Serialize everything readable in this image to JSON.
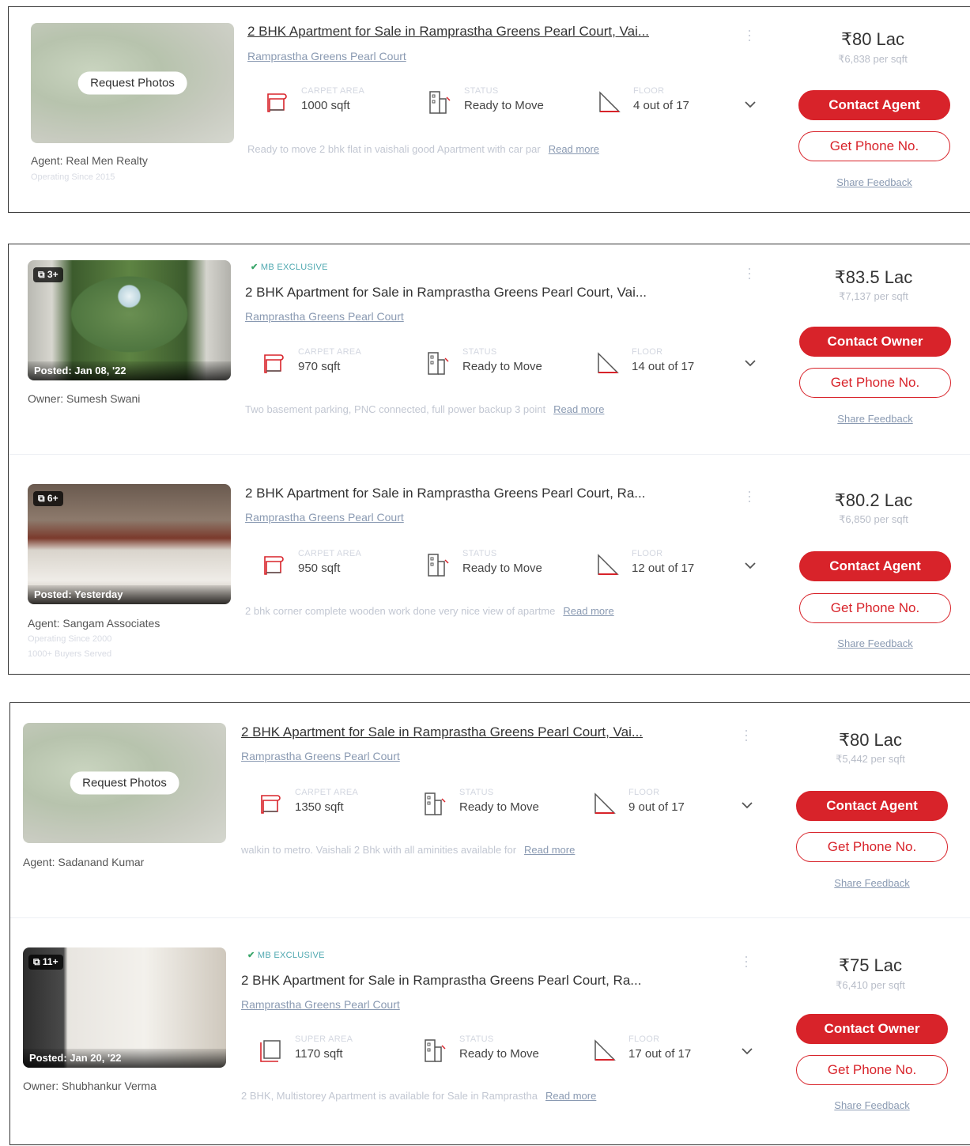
{
  "listings": [
    {
      "photo": {
        "type": "request",
        "request_label": "Request Photos"
      },
      "agent": "Agent: Real Men Realty",
      "agent_sub": [
        "Operating Since 2015"
      ],
      "exclusive": "",
      "title": "2 BHK Apartment for Sale in Ramprastha Greens Pearl Court, Vai...",
      "project": "Ramprastha Greens Pearl Court",
      "stats": [
        {
          "icon": "carpet-area-icon",
          "label": "CARPET AREA",
          "value": "1000 sqft"
        },
        {
          "icon": "status-icon",
          "label": "STATUS",
          "value": "Ready to Move"
        },
        {
          "icon": "floor-icon",
          "label": "FLOOR",
          "value": "4 out of 17"
        }
      ],
      "description": "Ready to move 2 bhk flat in vaishali good Apartment with car par",
      "read_more": "Read more",
      "price": "₹80 Lac",
      "per_sqft": "₹6,838 per sqft",
      "contact_label": "Contact Agent",
      "phone_label": "Get Phone No.",
      "feedback_label": "Share Feedback"
    },
    {
      "photo": {
        "type": "image",
        "count": "3+",
        "posted": "Posted: Jan 08, '22"
      },
      "agent": "Owner: Sumesh Swani",
      "agent_sub": [],
      "exclusive": "MB EXCLUSIVE",
      "title": "2 BHK Apartment for Sale in Ramprastha Greens Pearl Court, Vai...",
      "project": "Ramprastha Greens Pearl Court",
      "stats": [
        {
          "icon": "carpet-area-icon",
          "label": "CARPET AREA",
          "value": "970 sqft"
        },
        {
          "icon": "status-icon",
          "label": "STATUS",
          "value": "Ready to Move"
        },
        {
          "icon": "floor-icon",
          "label": "FLOOR",
          "value": "14 out of 17"
        }
      ],
      "description": "Two basement parking, PNC connected, full power backup 3 point",
      "read_more": "Read more",
      "price": "₹83.5 Lac",
      "per_sqft": "₹7,137 per sqft",
      "contact_label": "Contact Owner",
      "phone_label": "Get Phone No.",
      "feedback_label": "Share Feedback"
    },
    {
      "photo": {
        "type": "image",
        "count": "6+",
        "posted": "Posted: Yesterday"
      },
      "agent": "Agent: Sangam Associates",
      "agent_sub": [
        "Operating Since 2000",
        "1000+ Buyers Served"
      ],
      "exclusive": "",
      "title": "2 BHK Apartment for Sale in Ramprastha Greens Pearl Court, Ra...",
      "project": "Ramprastha Greens Pearl Court",
      "stats": [
        {
          "icon": "carpet-area-icon",
          "label": "CARPET AREA",
          "value": "950 sqft"
        },
        {
          "icon": "status-icon",
          "label": "STATUS",
          "value": "Ready to Move"
        },
        {
          "icon": "floor-icon",
          "label": "FLOOR",
          "value": "12 out of 17"
        }
      ],
      "description": "2 bhk corner complete wooden work done very nice view of apartme",
      "read_more": "Read more",
      "price": "₹80.2 Lac",
      "per_sqft": "₹6,850 per sqft",
      "contact_label": "Contact Agent",
      "phone_label": "Get Phone No.",
      "feedback_label": "Share Feedback"
    },
    {
      "photo": {
        "type": "request",
        "request_label": "Request Photos"
      },
      "agent": "Agent: Sadanand Kumar",
      "agent_sub": [],
      "exclusive": "",
      "title": "2 BHK Apartment for Sale in Ramprastha Greens Pearl Court, Vai...",
      "project": "Ramprastha Greens Pearl Court",
      "stats": [
        {
          "icon": "carpet-area-icon",
          "label": "CARPET AREA",
          "value": "1350 sqft"
        },
        {
          "icon": "status-icon",
          "label": "STATUS",
          "value": "Ready to Move"
        },
        {
          "icon": "floor-icon",
          "label": "FLOOR",
          "value": "9 out of 17"
        }
      ],
      "description": "walkin to metro. Vaishali 2 Bhk with all aminities available for",
      "read_more": "Read more",
      "price": "₹80 Lac",
      "per_sqft": "₹5,442 per sqft",
      "contact_label": "Contact Agent",
      "phone_label": "Get Phone No.",
      "feedback_label": "Share Feedback"
    },
    {
      "photo": {
        "type": "image",
        "count": "11+",
        "posted": "Posted: Jan 20, '22"
      },
      "agent": "Owner: Shubhankur Verma",
      "agent_sub": [],
      "exclusive": "MB EXCLUSIVE",
      "title": "2 BHK Apartment for Sale in Ramprastha Greens Pearl Court, Ra...",
      "project": "Ramprastha Greens Pearl Court",
      "stats": [
        {
          "icon": "super-area-icon",
          "label": "SUPER AREA",
          "value": "1170 sqft"
        },
        {
          "icon": "status-icon",
          "label": "STATUS",
          "value": "Ready to Move"
        },
        {
          "icon": "floor-icon",
          "label": "FLOOR",
          "value": "17 out of 17"
        }
      ],
      "description": "2 BHK, Multistorey Apartment is available for Sale in Ramprastha",
      "read_more": "Read more",
      "price": "₹75 Lac",
      "per_sqft": "₹6,410 per sqft",
      "contact_label": "Contact Owner",
      "phone_label": "Get Phone No.",
      "feedback_label": "Share Feedback"
    }
  ]
}
